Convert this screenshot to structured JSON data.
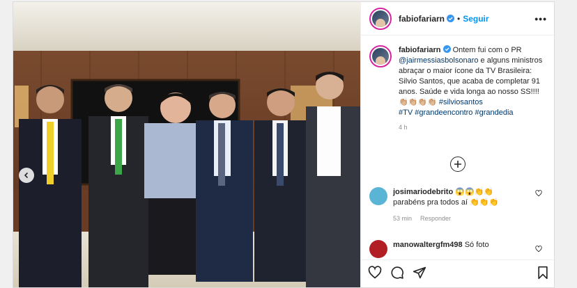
{
  "post": {
    "username": "fabiofariarn",
    "follow_label": "Seguir",
    "separator": "•",
    "more_label": "•••",
    "caption_username": "fabiofariarn",
    "caption_part1": " Ontem fui com o PR ",
    "caption_mention": "@jairmessiasbolsonaro",
    "caption_part2": " e alguns ministros abraçar o maior ícone da TV Brasileira: Silvio Santos, que acaba de completar 91 anos. Saúde e vida longa ao nosso SS!!!! ",
    "caption_emojis": "👏🏼👏🏼👏🏼👏🏼",
    "hashtag1": "#silviosantos",
    "hashtag2": "#TV",
    "hashtag3": "#grandeencontro",
    "hashtag4": "#grandedia",
    "time": "4 h"
  },
  "comments": [
    {
      "username": "josimariodebrito",
      "emojis": "😱😱👏👏",
      "text": "parabéns pra todos aí",
      "text_emojis": "👏👏👏",
      "time": "53 min",
      "reply_label": "Responder",
      "avatar_color": "#5ab4d6"
    },
    {
      "username": "manowaltergfm498",
      "text": " Só foto",
      "avatar_color": "#b11f24"
    }
  ],
  "icons": [
    "verified-icon",
    "more-icon",
    "chevron-left-icon",
    "add-comment-icon",
    "heart-icon",
    "comment-icon",
    "share-icon",
    "bookmark-icon"
  ],
  "colors": {
    "link": "#00376b",
    "follow": "#0095f6",
    "text": "#262626",
    "muted": "#8e8e8e"
  }
}
